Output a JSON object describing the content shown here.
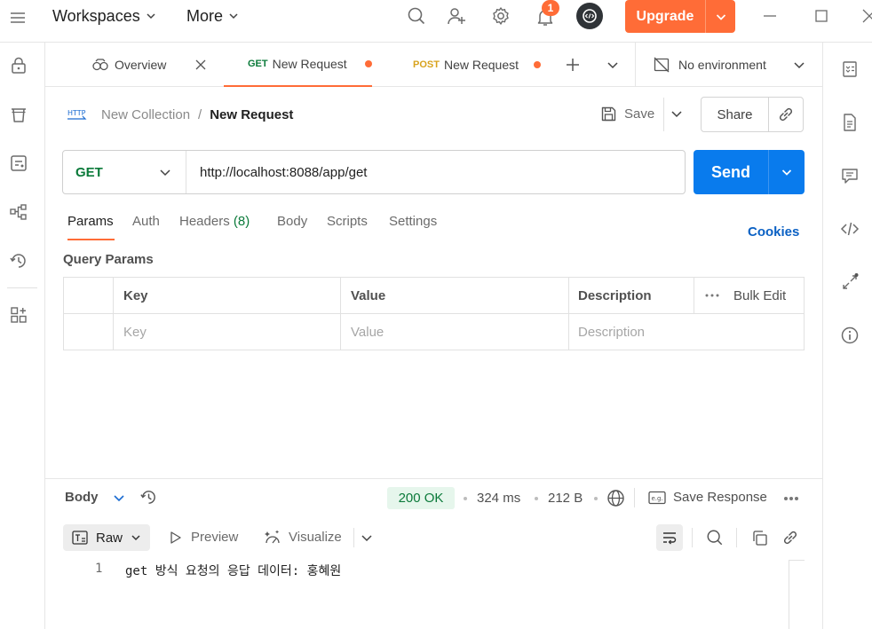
{
  "topbar": {
    "workspaces": "Workspaces",
    "more": "More",
    "notification_count": "1",
    "upgrade": "Upgrade"
  },
  "tabs": [
    {
      "label": "Overview"
    },
    {
      "method": "GET",
      "label": "New Request"
    },
    {
      "method": "POST",
      "label": "New Request"
    }
  ],
  "environment": "No environment",
  "breadcrumb": {
    "collection": "New Collection",
    "separator": "/",
    "request": "New Request",
    "http_badge": "HTTP"
  },
  "actions": {
    "save": "Save",
    "share": "Share"
  },
  "request": {
    "method": "GET",
    "url": "http://localhost:8088/app/get",
    "send": "Send"
  },
  "request_tabs": [
    {
      "label": "Params"
    },
    {
      "label": "Auth"
    },
    {
      "label": "Headers",
      "count": "(8)"
    },
    {
      "label": "Body"
    },
    {
      "label": "Scripts"
    },
    {
      "label": "Settings"
    }
  ],
  "cookies": "Cookies",
  "query_params": {
    "title": "Query Params",
    "headers": {
      "key": "Key",
      "value": "Value",
      "description": "Description",
      "bulk_edit": "Bulk Edit"
    },
    "placeholders": {
      "key": "Key",
      "value": "Value",
      "description": "Description"
    }
  },
  "response": {
    "body_label": "Body",
    "status": "200 OK",
    "time": "324 ms",
    "size": "212 B",
    "save_response": "Save Response",
    "format": "Raw",
    "preview": "Preview",
    "visualize": "Visualize",
    "lines": [
      {
        "number": "1",
        "text": "get 방식 요청의 응답 데이터: 홍혜원"
      }
    ]
  },
  "colors": {
    "accent": "#ff6c37",
    "send": "#097bed",
    "get": "#0b7a3a",
    "post": "#d8a31e",
    "link": "#0b61c4",
    "ok_bg": "#e6f6ec",
    "ok_text": "#0b7a3a"
  }
}
